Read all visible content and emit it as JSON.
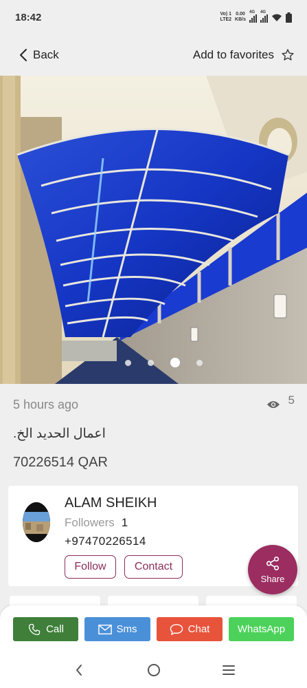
{
  "status_bar": {
    "time": "18:42",
    "network_top": "Vo) 1",
    "network_bottom": "LTE2",
    "speed_value": "0.00",
    "speed_unit": "KB/s",
    "sig1_label": "4G",
    "sig2_label": "4G",
    "icons": [
      "signal-icon",
      "signal-icon",
      "wifi-icon",
      "battery-icon"
    ]
  },
  "top_bar": {
    "back_label": "Back",
    "favorites_label": "Add to favorites"
  },
  "gallery": {
    "image_count": 4,
    "active_index": 2
  },
  "listing": {
    "posted": "5 hours ago",
    "views": "5",
    "title": "اعمال الحديد الخ.",
    "price": "70226514 QAR"
  },
  "seller": {
    "name": "ALAM SHEIKH",
    "followers_label": "Followers",
    "followers_count": "1",
    "phone": "+97470226514",
    "follow_label": "Follow",
    "contact_label": "Contact"
  },
  "share": {
    "label": "Share"
  },
  "actions": {
    "call_label": "Call",
    "sms_label": "Sms",
    "chat_label": "Chat",
    "whatsapp_label": "WhatsApp"
  },
  "colors": {
    "brand": "#9b2d61",
    "call": "#3f7f3a",
    "sms": "#4a90d9",
    "chat": "#e8533b",
    "whatsapp": "#4cd25a"
  }
}
